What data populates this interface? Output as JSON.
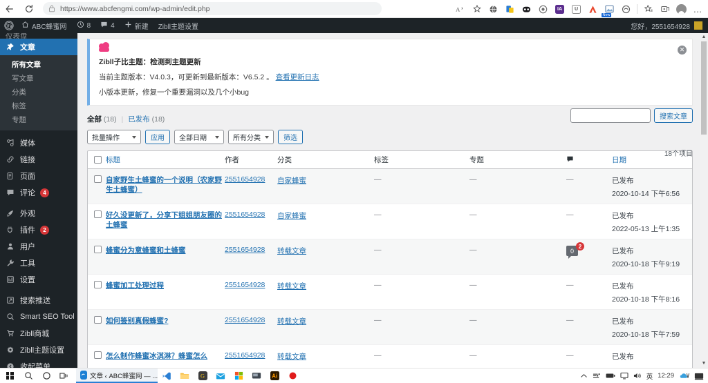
{
  "browser": {
    "back_icon": "back-arrow-icon",
    "reload_icon": "reload-icon",
    "url_full": "https://www.abcfengmi.com/wp-admin/edit.php",
    "url_scheme": "https://",
    "url_host": "www.abcfengmi.com",
    "url_path": "/wp-admin/edit.php",
    "lock_icon": "site-info-icon",
    "toolbar_icons": [
      "read-aloud-icon",
      "favorites-add-icon",
      "extension-globe-icon",
      "extension-bookmark-icon",
      "extension-dark-icon",
      "extension-circle-icon",
      "extension-ia-icon",
      "extension-u-icon",
      "extension-fox-icon",
      "extension-new-icon",
      "extension-ghost-icon",
      "collections-icon",
      "browser-essentials-icon",
      "profile-avatar-icon",
      "settings-more-icon"
    ],
    "ext_labels": {
      "ia": "IA",
      "u": "U",
      "new": "New"
    }
  },
  "adminbar": {
    "logo": "wordpress-logo-icon",
    "site_name": "ABC蜂蜜网",
    "home_icon": "home-icon",
    "updates_icon": "updates-icon",
    "updates_count": "8",
    "comments_icon": "comment-bubble-icon",
    "comments_count": "4",
    "new_icon": "plus-icon",
    "new_label": "新建",
    "theme_settings": "Zibll主题设置",
    "greeting": "您好，2551654928",
    "avatar": "user-avatar"
  },
  "sidebar": {
    "cut_top_label": "仪表盘",
    "items": [
      {
        "label": "文章",
        "icon": "pin-icon",
        "current": true
      },
      {
        "label": "媒体",
        "icon": "media-icon"
      },
      {
        "label": "链接",
        "icon": "link-icon"
      },
      {
        "label": "页面",
        "icon": "page-icon"
      },
      {
        "label": "评论",
        "icon": "comment-icon",
        "badge": "4"
      },
      {
        "label": "外观",
        "icon": "appearance-brush-icon"
      },
      {
        "label": "插件",
        "icon": "plugin-icon",
        "badge": "2"
      },
      {
        "label": "用户",
        "icon": "user-icon"
      },
      {
        "label": "工具",
        "icon": "wrench-icon"
      },
      {
        "label": "设置",
        "icon": "settings-sliders-icon"
      },
      {
        "label": "搜索推送",
        "icon": "push-icon"
      },
      {
        "label": "Smart SEO Tool",
        "icon": "seo-icon"
      },
      {
        "label": "Zibll商城",
        "icon": "cart-icon"
      },
      {
        "label": "Zibll主题设置",
        "icon": "gear-icon"
      },
      {
        "label": "收起菜单",
        "icon": "collapse-icon"
      }
    ],
    "submenu": [
      {
        "label": "所有文章",
        "current": true
      },
      {
        "label": "写文章"
      },
      {
        "label": "分类"
      },
      {
        "label": "标签"
      },
      {
        "label": "专题"
      }
    ]
  },
  "notice": {
    "title": "Zibll子比主题：检测到主题更新",
    "line_prefix": "当前主题版本：V4.0.3，可更新到最新版本：V6.5.2 。",
    "link": "查看更新日志",
    "sub": "小版本更新，修复一个重要漏洞以及几个小bug",
    "dismiss_icon": "close-icon",
    "cloud_icon": "cloud-icon",
    "accent": "#72aee6",
    "cloud_color": "#ef3d82"
  },
  "filters": {
    "all_label": "全部",
    "all_count": "(18)",
    "published_label": "已发布",
    "published_count": "(18)",
    "bulk_action": "批量操作",
    "apply": "应用",
    "date_filter": "全部日期",
    "category_filter": "所有分类",
    "filter_button": "筛选",
    "search_button": "搜索文章",
    "search_value": "",
    "search_placeholder": "",
    "item_count": "18个项目"
  },
  "table": {
    "columns": [
      "标题",
      "作者",
      "分类",
      "标签",
      "专题",
      "comment-icon",
      "日期"
    ],
    "rows": [
      {
        "title": "自家野生土蜂蜜的一个说明（农家野生土蜂蜜）",
        "author": "2551654928",
        "category": "自家蜂蜜",
        "tags": "—",
        "topic": "—",
        "comments": "—",
        "status": "已发布",
        "date": "2020-10-14 下午6:56"
      },
      {
        "title": "好久没更新了，分享下姐姐朋友圈的土蜂蜜",
        "author": "2551654928",
        "category": "自家蜂蜜",
        "tags": "—",
        "topic": "—",
        "comments": "—",
        "status": "已发布",
        "date": "2022-05-13 上午1:35"
      },
      {
        "title": "蜂蜜分为意蜂蜜和土蜂蜜",
        "author": "2551654928",
        "category": "转载文章",
        "tags": "—",
        "topic": "—",
        "comments": "0",
        "comments_pending": "2",
        "status": "已发布",
        "date": "2020-10-18 下午9:19"
      },
      {
        "title": "蜂蜜加工处理过程",
        "author": "2551654928",
        "category": "转载文章",
        "tags": "—",
        "topic": "—",
        "comments": "—",
        "status": "已发布",
        "date": "2020-10-18 下午8:16"
      },
      {
        "title": "如何鉴别真假蜂蜜?",
        "author": "2551654928",
        "category": "转载文章",
        "tags": "—",
        "topic": "—",
        "comments": "—",
        "status": "已发布",
        "date": "2020-10-18 下午7:59"
      },
      {
        "title": "怎么制作蜂蜜冰淇淋？蜂蜜怎么",
        "author": "2551654928",
        "category": "转载文章",
        "tags": "—",
        "topic": "—",
        "comments": "—",
        "status": "已发布",
        "date": ""
      }
    ]
  },
  "taskbar": {
    "start_icon": "windows-start-icon",
    "search_icon": "search-icon",
    "cortana_icon": "cortana-circle-icon",
    "taskview_icon": "task-view-icon",
    "active_window": "文章 ‹ ABC蜂蜜网 — ...",
    "apps": [
      "vscode-icon",
      "file-explorer-icon",
      "app-g-icon",
      "mail-icon",
      "store-icon",
      "app-dark-icon",
      "illustrator-icon",
      "record-red-icon"
    ],
    "tray": [
      "chevron-up-icon",
      "network-icon",
      "battery-icon",
      "monitor-icon",
      "volume-icon"
    ],
    "ime": "英",
    "clock": "12:29",
    "notify_icon": "onedrive-icon",
    "action_center_icon": "action-center-icon"
  }
}
